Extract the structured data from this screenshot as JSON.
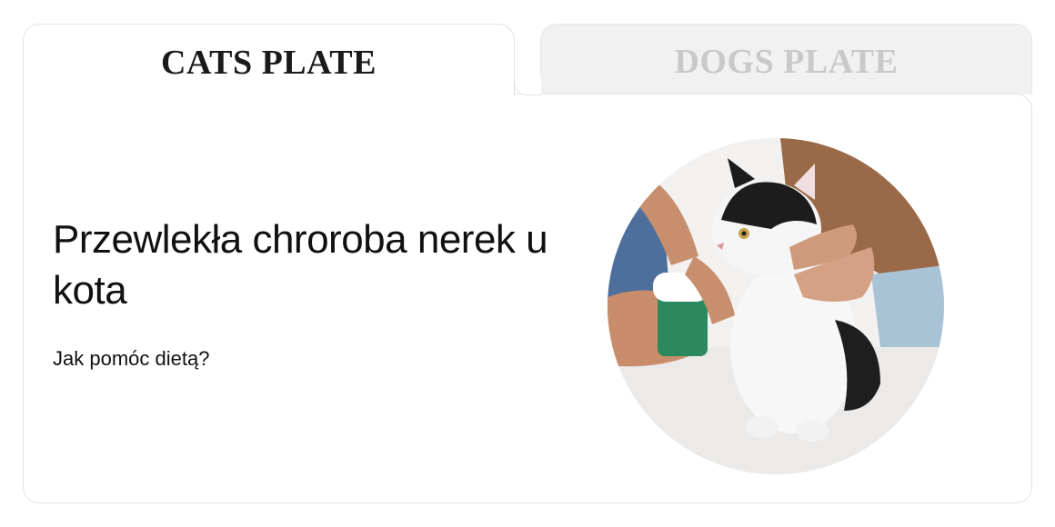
{
  "tabs": [
    {
      "label": "CATS PLATE",
      "active": true
    },
    {
      "label": "DOGS PLATE",
      "active": false
    }
  ],
  "article": {
    "title": "Przewlekła chroroba nerek u kota",
    "subtitle": "Jak pomóc dietą?"
  },
  "image": {
    "subject": "cat-receiving-medication"
  },
  "colors": {
    "active_tab_text": "#1a1a1a",
    "inactive_tab_text": "#c9c9c9",
    "inactive_tab_bg": "#f1f1f1",
    "border": "#e3e3e3"
  }
}
